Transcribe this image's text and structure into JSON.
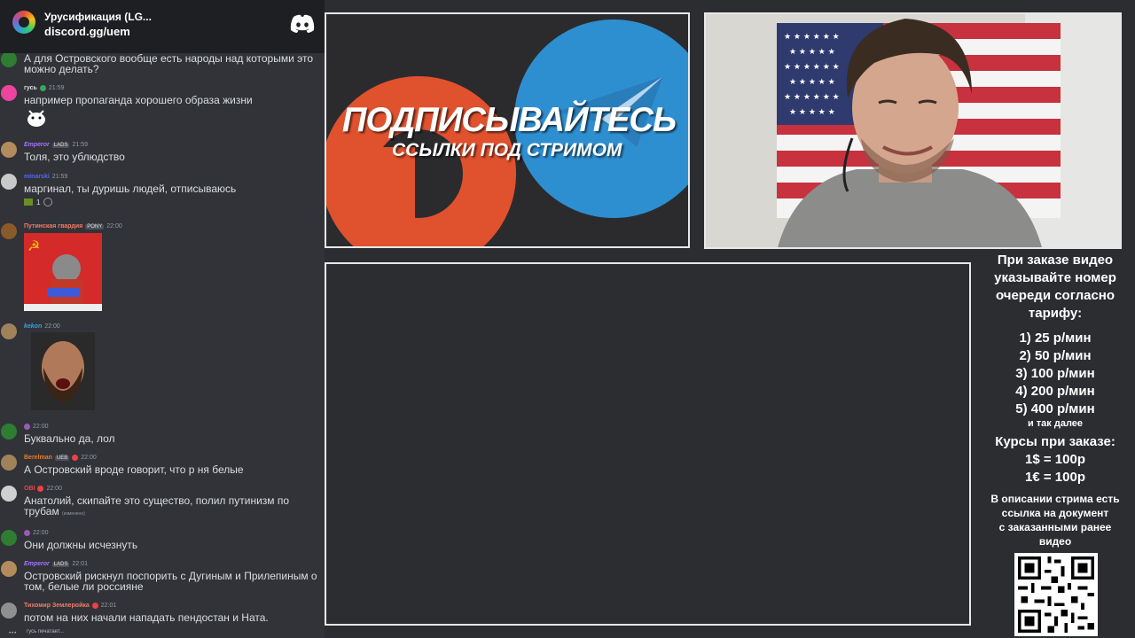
{
  "server": {
    "title": "Урусификация (LG...",
    "link": "discord.gg/uem",
    "icon": "discord-logo-icon"
  },
  "chat": {
    "messages": [
      {
        "text": "А для Островского вообще есть народы над которыми это можно делать?"
      },
      {
        "author": "гусь",
        "time": "21:59",
        "text": "например пропаганда хорошего образа жизни",
        "color": "#dbdee1"
      },
      {
        "author": "Emperor",
        "tag": "LADS",
        "time": "21:59",
        "text": "Толя, это ублюдство",
        "color": "#a970ff"
      },
      {
        "author": "minarski",
        "time": "21:59",
        "text": "маргинал, ты дуришь людей, отписываюсь",
        "reaction_count": "1",
        "color": "#5865f2"
      },
      {
        "author": "Путинская гвардия",
        "tag": "PONY",
        "time": "22:00",
        "color": "#f47b67"
      },
      {
        "author": "kekon",
        "time": "22:00",
        "color": "#3ba0e6"
      },
      {
        "time": "22:00",
        "text": "Буквально да, лол"
      },
      {
        "author": "Berelman",
        "tag": "UEB",
        "time": "22:00",
        "text": "А Островский вроде говорит, что р ня белые",
        "color": "#e67e22"
      },
      {
        "author": "OBI",
        "time": "22:00",
        "text": "Анатолий, скипайте это существо, полил путинизм по трубам",
        "edited": "(изменено)",
        "color": "#ed4245"
      },
      {
        "time": "22:00",
        "text": "Они должны исчезнуть"
      },
      {
        "author": "Emperor",
        "tag": "LADS",
        "time": "22:01",
        "text": "Островский рискнул поспорить с Дугиным и Прилепиным о том, белые ли россияне",
        "color": "#a970ff"
      },
      {
        "author": "Тихомир Землеройка",
        "time": "22:01",
        "text": "потом на них начали нападать пендостан и Ната.",
        "color": "#f47b67"
      }
    ],
    "typing": "гусь печатает..."
  },
  "promo": {
    "title": "ПОДПИСЫВАЙТЕСЬ",
    "subtitle": "ССЫЛКИ ПОД СТРИМОМ"
  },
  "info": {
    "heading": [
      "При заказе видео",
      "указывайте номер",
      "очереди согласно",
      "тарифу:"
    ],
    "tariffs": [
      "1) 25 р/мин",
      "2) 50 р/мин",
      "3) 100 р/мин",
      "4) 200 р/мин",
      "5) 400 р/мин"
    ],
    "etc": "и так далее",
    "rates_title": "Курсы при заказе:",
    "rates": [
      "1$ = 100р",
      "1€ = 100р"
    ],
    "note": [
      "В описании стрима есть",
      "ссылка на документ",
      "с заказанными ранее",
      "видео"
    ]
  }
}
